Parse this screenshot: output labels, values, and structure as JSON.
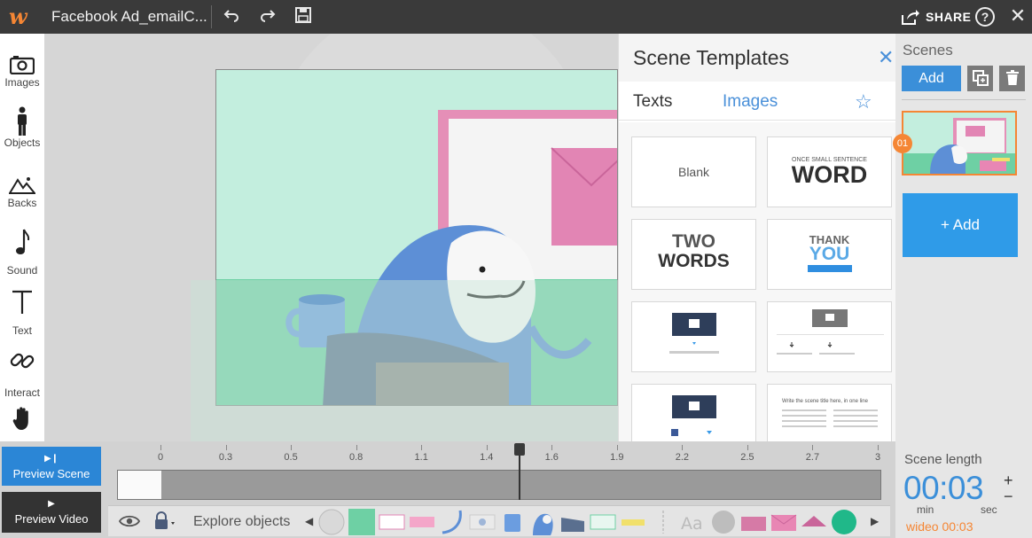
{
  "app": {
    "doc_title": "Facebook Ad_emailC...",
    "share_label": "SHARE",
    "help_label": "?",
    "brand_color": "#f58634",
    "accent_color": "#3b8fd9"
  },
  "toolbar": {
    "undo_icon": "undo-icon",
    "redo_icon": "redo-icon",
    "save_icon": "save-icon"
  },
  "left_tools": [
    {
      "label": "Images",
      "icon": "camera-icon"
    },
    {
      "label": "Objects",
      "icon": "person-icon"
    },
    {
      "label": "Backs",
      "icon": "mountain-icon"
    },
    {
      "label": "Sound",
      "icon": "music-note-icon"
    },
    {
      "label": "Text",
      "icon": "text-t-icon"
    },
    {
      "label": "Interact",
      "icon": "link-icon"
    },
    {
      "label": "",
      "icon": "hand-icon"
    }
  ],
  "templates_panel": {
    "title": "Scene Templates",
    "tabs": [
      "Texts",
      "Images"
    ],
    "active_tab": "Images",
    "cards": {
      "blank": "Blank",
      "word_small": "ONCE SMALL SENTENCE",
      "word_big": "WORD",
      "two_line1": "TWO",
      "two_line2": "WORDS",
      "thank": "THANK",
      "you": "YOU",
      "scene_title": "Write the scene title here, in one line"
    }
  },
  "scenes_panel": {
    "title": "Scenes",
    "add_label": "Add",
    "add_big_label": "+ Add",
    "scene_number": "01"
  },
  "preview": {
    "scene_label": "Preview Scene",
    "video_label": "Preview Video"
  },
  "timeline": {
    "ticks": [
      "0",
      "0.3",
      "0.5",
      "0.8",
      "1.1",
      "1.4",
      "1.6",
      "1.9",
      "2.2",
      "2.5",
      "2.7",
      "3"
    ],
    "playhead_fraction": 0.5
  },
  "object_bar": {
    "explore_label": "Explore objects"
  },
  "scene_length": {
    "label": "Scene length",
    "time": "00:03",
    "min_label": "min",
    "sec_label": "sec",
    "wideo_label": "wideo 00:03"
  }
}
